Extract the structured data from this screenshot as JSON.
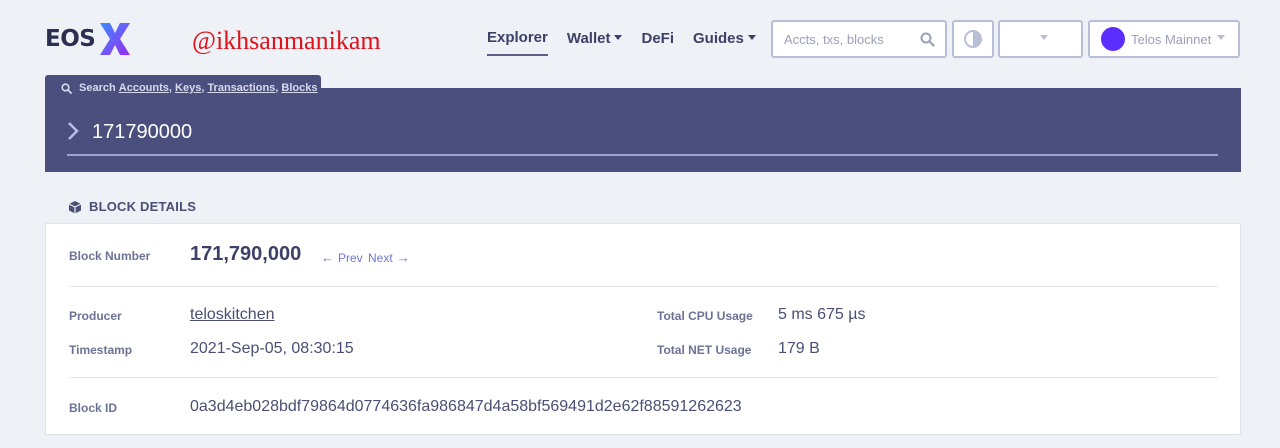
{
  "header": {
    "logo_text": "EOS",
    "watermark": "@ikhsanmanikam",
    "nav": [
      {
        "label": "Explorer",
        "active": true,
        "dropdown": false
      },
      {
        "label": "Wallet",
        "active": false,
        "dropdown": true
      },
      {
        "label": "DeFi",
        "active": false,
        "dropdown": false
      },
      {
        "label": "Guides",
        "active": false,
        "dropdown": true
      }
    ],
    "search_placeholder": "Accts, txs, blocks",
    "network_label": "Telos Mainnet",
    "network_color": "#5b2eff"
  },
  "search_banner": {
    "tab_prefix": "Search",
    "tab_links": [
      "Accounts",
      "Keys",
      "Transactions",
      "Blocks"
    ],
    "query": "171790000"
  },
  "block_details": {
    "section_title": "BLOCK DETAILS",
    "block_number_label": "Block Number",
    "block_number": "171,790,000",
    "prev_label": "Prev",
    "next_label": "Next",
    "producer_label": "Producer",
    "producer": "teloskitchen",
    "timestamp_label": "Timestamp",
    "timestamp": "2021-Sep-05, 08:30:15",
    "cpu_label": "Total CPU Usage",
    "cpu": "5 ms 675 µs",
    "net_label": "Total NET Usage",
    "net": "179 B",
    "block_id_label": "Block ID",
    "block_id": "0a3d4eb028bdf79864d0774636fa986847d4a58bf569491d2e62f88591262623"
  },
  "colors": {
    "banner": "#4a4f7e",
    "accent_link": "#6f78d6",
    "logo_x": "#6a3cf5"
  }
}
